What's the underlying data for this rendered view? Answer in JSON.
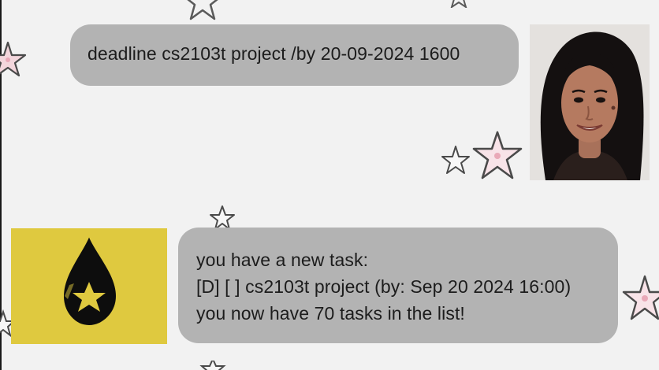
{
  "conversation": {
    "user_message": {
      "text": "deadline cs2103t project /by 20-09-2024 1600",
      "avatar": "user-portrait-photo"
    },
    "bot_message": {
      "lines": [
        "you have a new task:",
        "[D] [ ] cs2103t project (by: Sep 20 2024 16:00)",
        "you now have 70 tasks in the list!"
      ],
      "avatar": "droplet-star-logo"
    }
  },
  "colors": {
    "background": "#f2f2f2",
    "bubble": "#b3b3b3",
    "bot_avatar_bg": "#dfc93f",
    "text": "#1c1c1c"
  }
}
